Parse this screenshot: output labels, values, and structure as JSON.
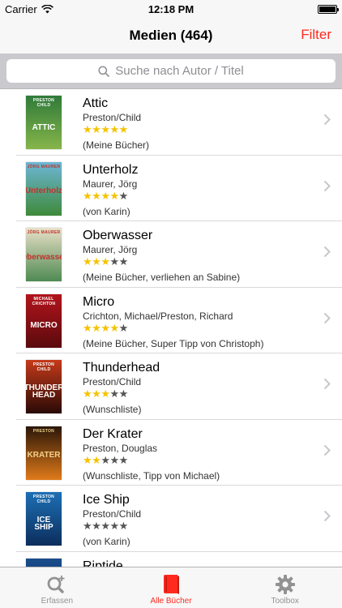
{
  "status_bar": {
    "carrier": "Carrier",
    "time": "12:18 PM"
  },
  "nav": {
    "title": "Medien (464)",
    "filter_label": "Filter"
  },
  "search": {
    "placeholder": "Suche nach Autor / Titel"
  },
  "books": [
    {
      "title": "Attic",
      "author": "Preston/Child",
      "rating": 5,
      "note": "(Meine Bücher)",
      "cover": {
        "author": "PRESTON CHILD",
        "title": "ATTIC",
        "bg": "#2f7a3a",
        "bg2": "#86b54a",
        "fg": "#ffffff"
      }
    },
    {
      "title": "Unterholz",
      "author": "Maurer, Jörg",
      "rating": 4,
      "note": "(von Karin)",
      "cover": {
        "author": "JÖRG MAURER",
        "title": "Unterholz",
        "bg": "#6cb6d6",
        "bg2": "#3f8a3a",
        "fg": "#c0322d"
      }
    },
    {
      "title": "Oberwasser",
      "author": "Maurer, Jörg",
      "rating": 3,
      "note": "(Meine Bücher, verliehen an Sabine)",
      "cover": {
        "author": "JÖRG MAURER",
        "title": "Oberwasser",
        "bg": "#e8e0c8",
        "bg2": "#4f8a52",
        "fg": "#c0322d"
      }
    },
    {
      "title": "Micro",
      "author": "Crichton, Michael/Preston, Richard",
      "rating": 4,
      "note": "(Meine Bücher, Super Tipp von Christoph)",
      "cover": {
        "author": "MICHAEL CRICHTON",
        "title": "MICRO",
        "bg": "#b2141b",
        "bg2": "#5a0a0e",
        "fg": "#ffffff"
      }
    },
    {
      "title": "Thunderhead",
      "author": "Preston/Child",
      "rating": 3,
      "note": "(Wunschliste)",
      "cover": {
        "author": "PRESTON CHILD",
        "title": "THUNDER HEAD",
        "bg": "#c53a1a",
        "bg2": "#2a0a06",
        "fg": "#ffffff"
      }
    },
    {
      "title": "Der Krater",
      "author": "Preston, Douglas",
      "rating": 2,
      "note": "(Wunschliste, Tipp von Michael)",
      "cover": {
        "author": "PRESTON",
        "title": "KRATER",
        "bg": "#2a1608",
        "bg2": "#e07a1a",
        "fg": "#f3d28a"
      }
    },
    {
      "title": "Ice Ship",
      "author": "Preston/Child",
      "rating": 0,
      "note": "(von Karin)",
      "cover": {
        "author": "PRESTON CHILD",
        "title": "ICE SHIP",
        "bg": "#1d6fb5",
        "bg2": "#0c2e5c",
        "fg": "#ffffff"
      }
    },
    {
      "title": "Riptide",
      "author": "",
      "rating": 0,
      "note": "",
      "cover": {
        "author": "",
        "title": "",
        "bg": "#1a4d8c",
        "bg2": "#0c2e5c",
        "fg": "#ffffff"
      }
    }
  ],
  "tabs": [
    {
      "label": "Erfassen",
      "icon": "search-add-icon",
      "active": false
    },
    {
      "label": "Alle Bücher",
      "icon": "book-icon",
      "active": true
    },
    {
      "label": "Toolbox",
      "icon": "gear-icon",
      "active": false
    }
  ],
  "colors": {
    "accent": "#ff2a1f",
    "star_on": "#f5c300",
    "star_off": "#555555"
  }
}
